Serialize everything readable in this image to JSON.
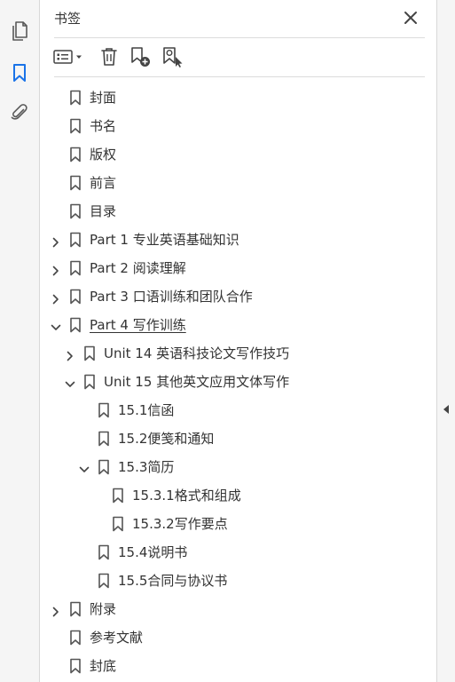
{
  "panel": {
    "title": "书签"
  },
  "rail": {
    "items": [
      {
        "icon": "pages-icon"
      },
      {
        "icon": "bookmark-icon",
        "active": true
      },
      {
        "icon": "attachment-icon"
      }
    ]
  },
  "colors": {
    "accent": "#1a73e8",
    "icon_gray": "#595959",
    "text": "#333333"
  },
  "bookmarks": [
    {
      "label": "封面",
      "level": 0,
      "twisty": "none"
    },
    {
      "label": "书名",
      "level": 0,
      "twisty": "none"
    },
    {
      "label": "版权",
      "level": 0,
      "twisty": "none"
    },
    {
      "label": "前言",
      "level": 0,
      "twisty": "none"
    },
    {
      "label": "目录",
      "level": 0,
      "twisty": "none"
    },
    {
      "label": "Part 1  专业英语基础知识",
      "level": 0,
      "twisty": "collapsed"
    },
    {
      "label": "Part 2  阅读理解",
      "level": 0,
      "twisty": "collapsed"
    },
    {
      "label": "Part 3  口语训练和团队合作",
      "level": 0,
      "twisty": "collapsed"
    },
    {
      "label": "Part 4  写作训练",
      "level": 0,
      "twisty": "expanded",
      "selected": true
    },
    {
      "label": "Unit 14  英语科技论文写作技巧",
      "level": 1,
      "twisty": "collapsed"
    },
    {
      "label": "Unit 15  其他英文应用文体写作",
      "level": 1,
      "twisty": "expanded"
    },
    {
      "label": "15.1信函",
      "level": 2,
      "twisty": "none"
    },
    {
      "label": "15.2便笺和通知",
      "level": 2,
      "twisty": "none"
    },
    {
      "label": "15.3简历",
      "level": 2,
      "twisty": "expanded"
    },
    {
      "label": "15.3.1格式和组成",
      "level": 3,
      "twisty": "none"
    },
    {
      "label": "15.3.2写作要点",
      "level": 3,
      "twisty": "none"
    },
    {
      "label": "15.4说明书",
      "level": 2,
      "twisty": "none"
    },
    {
      "label": "15.5合同与协议书",
      "level": 2,
      "twisty": "none"
    },
    {
      "label": "附录",
      "level": 0,
      "twisty": "collapsed"
    },
    {
      "label": "参考文献",
      "level": 0,
      "twisty": "none"
    },
    {
      "label": "封底",
      "level": 0,
      "twisty": "none"
    }
  ]
}
